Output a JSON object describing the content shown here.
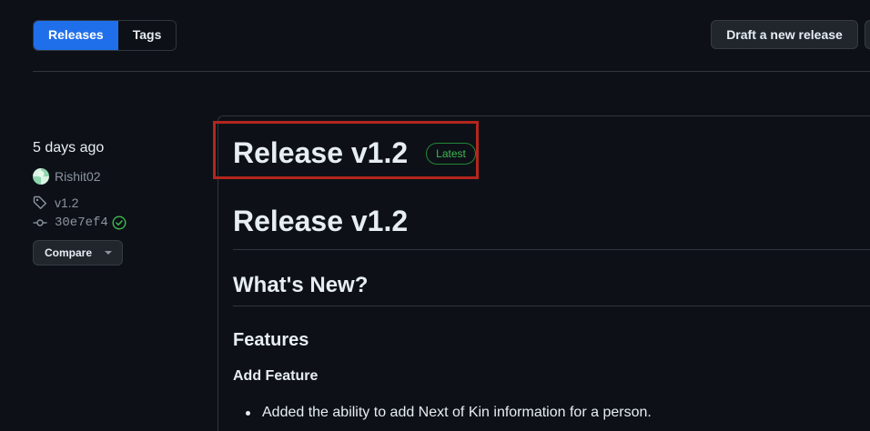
{
  "header": {
    "tabs": [
      {
        "label": "Releases",
        "active": true
      },
      {
        "label": "Tags",
        "active": false
      }
    ],
    "draft_button": "Draft a new release"
  },
  "sidebar": {
    "date": "5 days ago",
    "author": "Rishit02",
    "tag": "v1.2",
    "commit": "30e7ef4",
    "compare_button": "Compare"
  },
  "release": {
    "title": "Release v1.2",
    "badge": "Latest",
    "body": {
      "h1": "Release v1.2",
      "h2": "What's New?",
      "h3": "Features",
      "h4": "Add Feature",
      "bullets": [
        "Added the ability to add Next of Kin information for a person."
      ]
    }
  },
  "colors": {
    "background": "#0d1117",
    "accent": "#1f6feb",
    "latest_green": "#3fb950",
    "highlight_red": "#b3261e"
  },
  "icons": {
    "tag": "tag-icon",
    "commit": "git-commit-icon",
    "check": "check-circle-icon",
    "caret": "chevron-down-icon"
  }
}
